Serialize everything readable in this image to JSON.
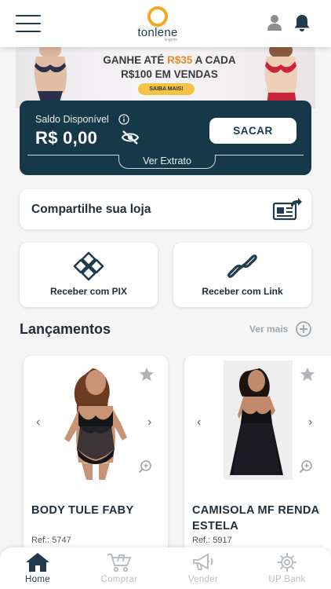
{
  "header": {
    "logo_text": "tonlene",
    "logo_sub": "lingerie"
  },
  "banner": {
    "line1_prefix": "GANHE ATÉ ",
    "line1_highlight": "R$35",
    "line1_suffix": " A CADA",
    "line2": "R$100 EM VENDAS",
    "button": "SAIBA MAIS!"
  },
  "balance": {
    "label": "Saldo Disponível",
    "value": "R$ 0,00",
    "withdraw_button": "SACAR",
    "statement_link": "Ver Extrato"
  },
  "share": {
    "label": "Compartilhe sua loja"
  },
  "actions": [
    {
      "label": "Receber com PIX",
      "icon": "pix-icon"
    },
    {
      "label": "Receber com Link",
      "icon": "link-icon"
    }
  ],
  "launches": {
    "title": "Lançamentos",
    "see_more": "Ver mais"
  },
  "products": [
    {
      "name": "BODY TULE FABY",
      "ref": "Ref.: 5747"
    },
    {
      "name": "CAMISOLA MF RENDA ESTELA",
      "ref": "Ref.: 5917"
    }
  ],
  "nav": [
    {
      "label": "Home",
      "icon": "home-icon",
      "active": true
    },
    {
      "label": "Comprar",
      "icon": "cart-icon",
      "active": false
    },
    {
      "label": "Vender",
      "icon": "megaphone-icon",
      "active": false
    },
    {
      "label": "UP Bank",
      "icon": "gear-icon",
      "active": false
    }
  ],
  "colors": {
    "primary": "#16394a",
    "accent": "#f5a623",
    "banner_button": "#f6c445",
    "background": "#f5f5f5"
  }
}
